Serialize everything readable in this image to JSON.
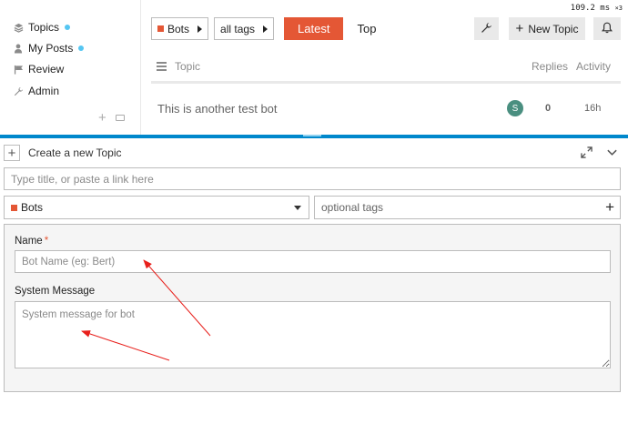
{
  "perf": {
    "time": "109.2 ms",
    "multiplier": "×3"
  },
  "sidebar": {
    "items": [
      {
        "label": "Topics",
        "icon": "layers-icon",
        "unread": true
      },
      {
        "label": "My Posts",
        "icon": "user-icon",
        "unread": true
      },
      {
        "label": "Review",
        "icon": "flag-icon",
        "unread": false
      },
      {
        "label": "Admin",
        "icon": "wrench-icon",
        "unread": false
      }
    ]
  },
  "nav": {
    "category": "Bots",
    "tags": "all tags",
    "latest": "Latest",
    "top": "Top",
    "new_topic": "New Topic"
  },
  "table": {
    "headers": {
      "topic": "Topic",
      "replies": "Replies",
      "activity": "Activity"
    },
    "rows": [
      {
        "title": "This is another test bot",
        "avatar": "S",
        "replies": "0",
        "activity": "16h"
      }
    ]
  },
  "composer": {
    "heading": "Create a new Topic",
    "title_placeholder": "Type title, or paste a link here",
    "category": "Bots",
    "tags_placeholder": "optional tags",
    "name_label": "Name",
    "required_mark": "*",
    "name_placeholder": "Bot Name (eg: Bert)",
    "system_label": "System Message",
    "system_placeholder": "System message for bot"
  },
  "colors": {
    "accent": "#e45735",
    "category": "#e45735",
    "composer_bar": "#0088cc",
    "unread_dot": "#55c6f2",
    "avatar": "#4a8f80",
    "annotation_arrow": "#e8201c"
  }
}
